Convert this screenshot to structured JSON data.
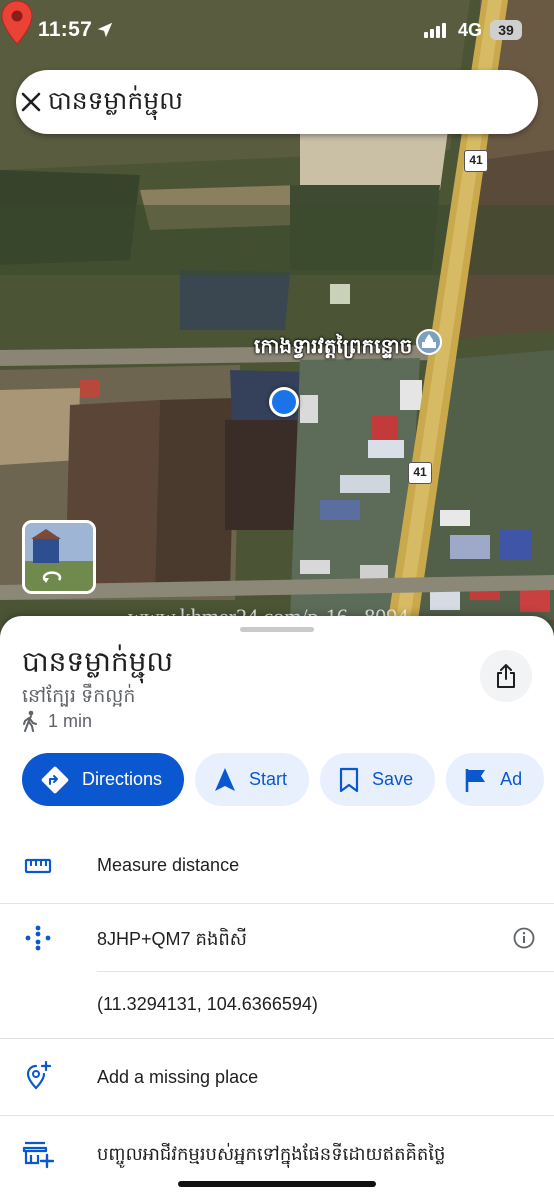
{
  "status_bar": {
    "time": "11:57",
    "network": "4G",
    "battery": "39"
  },
  "search": {
    "query": "បានទម្លាក់ម្ជុល"
  },
  "map": {
    "place_label": "កោងទ្វារវត្តព្រៃកន្ទោច",
    "road_shields": [
      "41",
      "41"
    ],
    "watermark": "www.khmer24.com/p-16...8094"
  },
  "sheet": {
    "title": "បានទម្លាក់ម្ជុល",
    "subtitle": "នៅក្បែរ ទឹកល្អក់",
    "walk_time": "1 min",
    "actions": [
      "Directions",
      "Start",
      "Save",
      "Ad"
    ],
    "rows": {
      "measure": "Measure distance",
      "plus_code": "8JHP+QM7 គងពិសី",
      "coordinates": "(11.3294131, 104.6366594)",
      "add_place": "Add a missing place",
      "business": "បញ្ចូលអាជីវកម្មរបស់អ្នកទៅក្នុងផែនទីដោយឥតគិតថ្លៃ"
    }
  },
  "colors": {
    "accent": "#0b57d0",
    "chip_bg": "#e8f0fe",
    "pin": "#ea4335",
    "location_dot": "#1a73e8"
  }
}
